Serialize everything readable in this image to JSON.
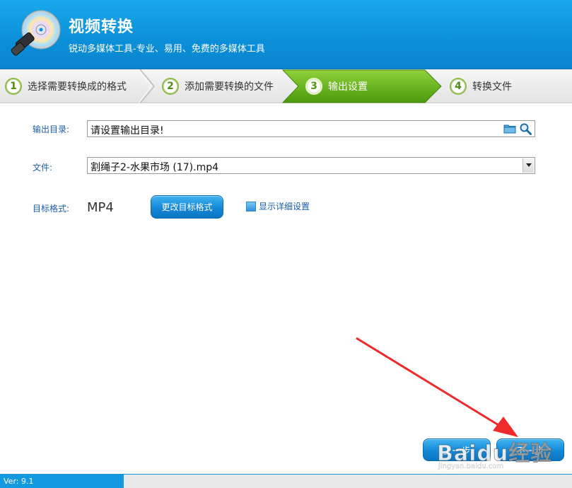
{
  "app": {
    "title": "视频转换",
    "subtitle": "锐动多媒体工具-专业、易用、免费的多媒体工具"
  },
  "steps": [
    {
      "num": "1",
      "label": "选择需要转换成的格式",
      "active": false
    },
    {
      "num": "2",
      "label": "添加需要转换的文件",
      "active": false
    },
    {
      "num": "3",
      "label": "输出设置",
      "active": true
    },
    {
      "num": "4",
      "label": "转换文件",
      "active": false
    }
  ],
  "form": {
    "output_dir_label": "输出目录:",
    "output_dir_value": "请设置输出目录!",
    "file_label": "文件:",
    "file_value": "割绳子2-水果市场 (17).mp4",
    "target_format_label": "目标格式:",
    "target_format_value": "MP4",
    "change_format_button": "更改目标格式",
    "show_details_label": "显示详细设置",
    "show_details_checked": false
  },
  "nav": {
    "prev_label": "上一步",
    "next_label": "下一步"
  },
  "status": {
    "version": "Ver: 9.1"
  },
  "watermark": {
    "main": "Baidu经验",
    "sub": "jingyan.baidu.com"
  },
  "colors": {
    "header": "#0b8fd8",
    "active_step": "#5aaa12",
    "label_blue": "#1a5da8",
    "annotation_arrow": "#ee2a2a"
  },
  "icons": [
    "app-cd-logo-icon",
    "folder-icon",
    "search-icon",
    "chevron-down-icon"
  ]
}
